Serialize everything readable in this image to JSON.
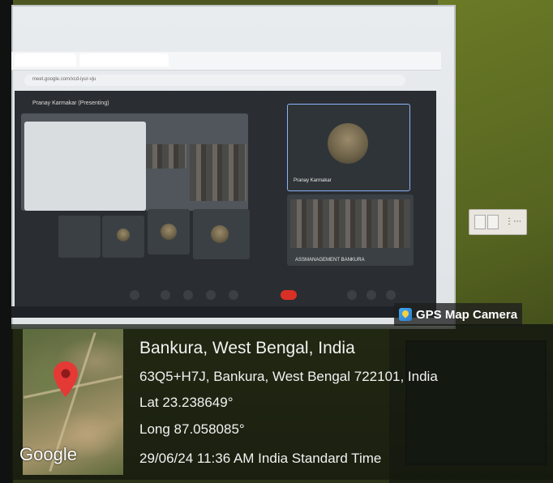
{
  "badge": {
    "label": "GPS Map Camera",
    "icon": "gps-map-camera-icon"
  },
  "location": {
    "place": "Bankura, West Bengal, India",
    "address": "63Q5+H7J, Bankura, West Bengal 722101, India",
    "latitude": "Lat 23.238649°",
    "longitude": "Long 87.058085°",
    "timestamp": "29/06/24 11:36 AM India Standard Time"
  },
  "map": {
    "brand": "Google",
    "pin_icon": "map-pin-icon",
    "pin_color": "#e53935"
  },
  "projected_screen": {
    "meeting_owner": "Pranay Karmakar (Presenting)",
    "tile_name": "Pranay Karmakar",
    "room_label": "ASSMANAGEMENT BANKURA",
    "url": "meet.google.com/xcd-iyur-vju"
  }
}
